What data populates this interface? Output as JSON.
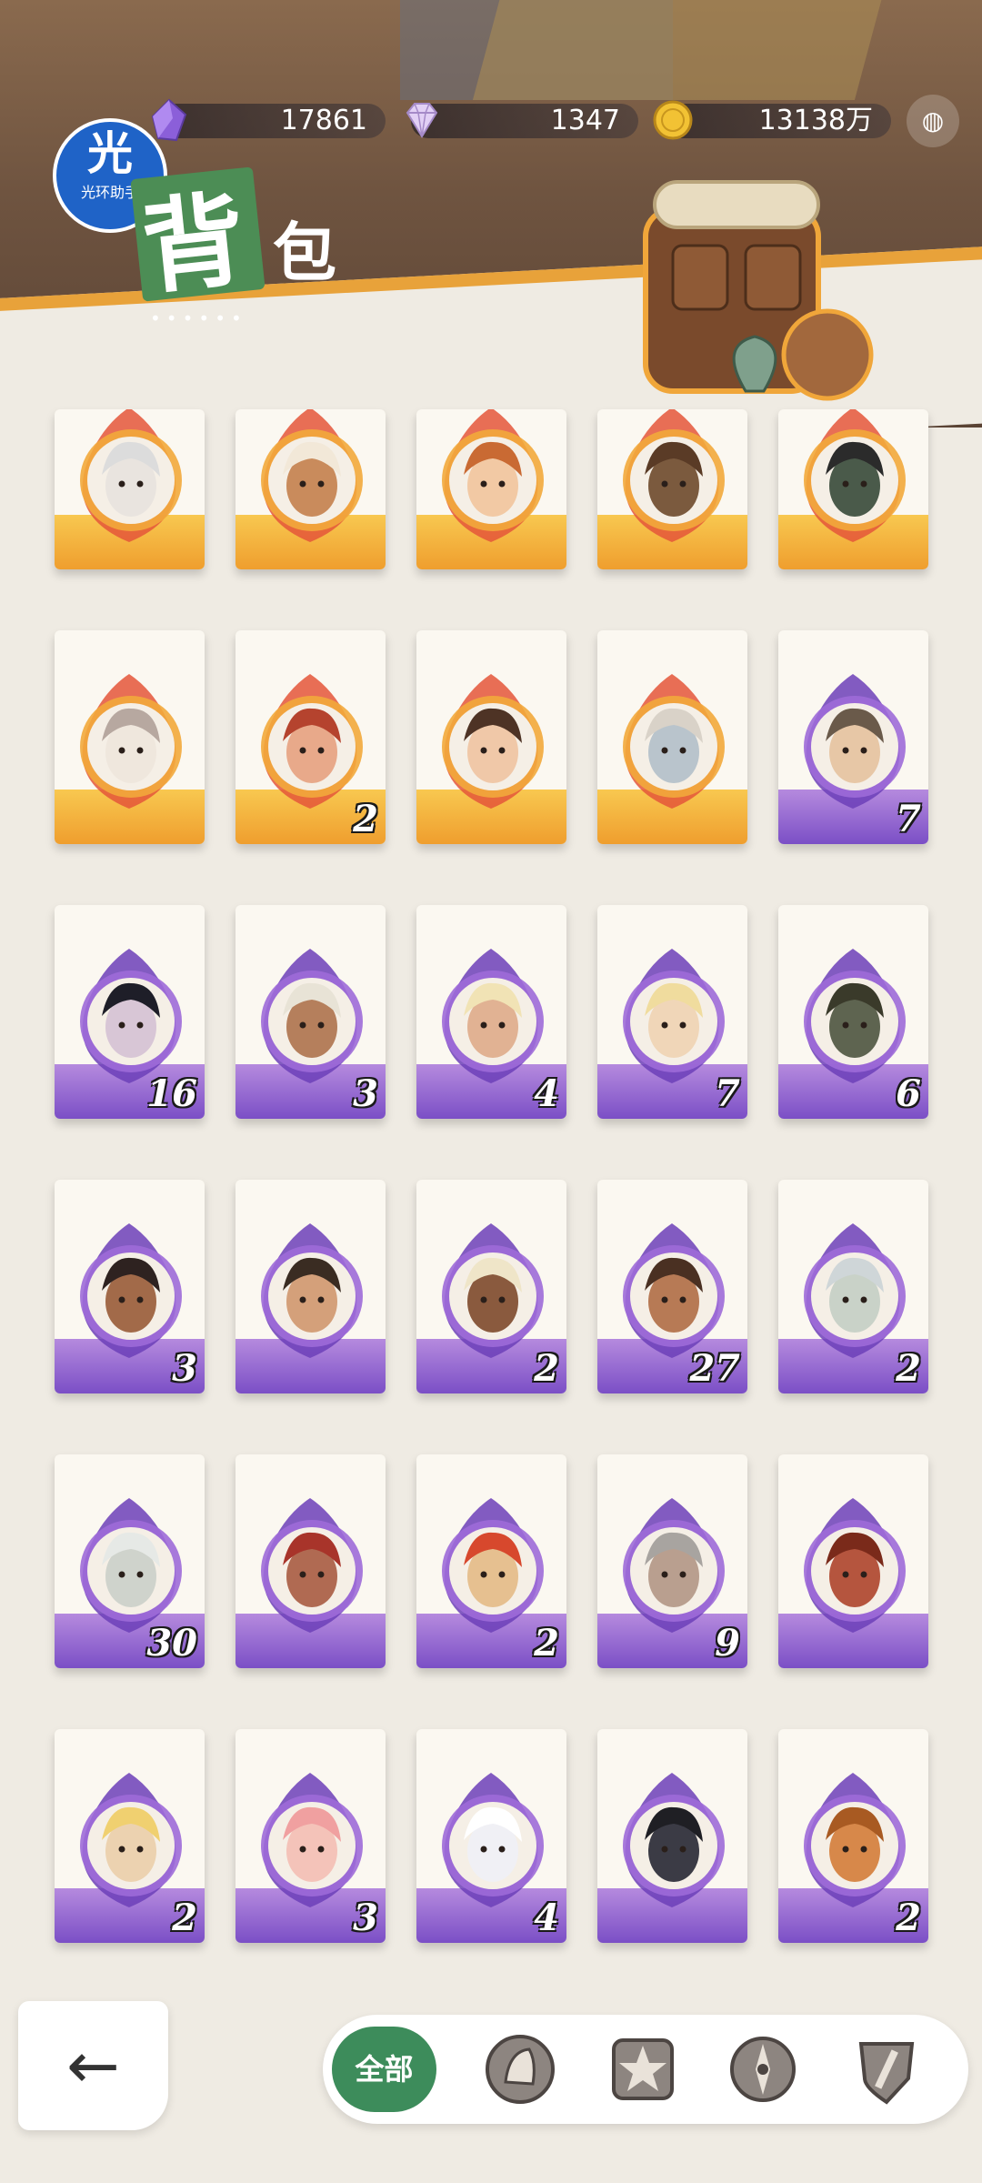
{
  "resources": [
    {
      "name": "purple-crystal",
      "value": "17861",
      "color": "#8b5fd9"
    },
    {
      "name": "diamond",
      "value": "1347",
      "color": "#d9c2f0"
    },
    {
      "name": "gold-coin",
      "value": "13138万",
      "color": "#e2b12c"
    }
  ],
  "badge": {
    "big": "光",
    "small": "光环助手"
  },
  "title": {
    "first": "背",
    "second": "包"
  },
  "cards": [
    {
      "rarity": "gold",
      "count": ""
    },
    {
      "rarity": "gold",
      "count": ""
    },
    {
      "rarity": "gold",
      "count": ""
    },
    {
      "rarity": "gold",
      "count": ""
    },
    {
      "rarity": "gold",
      "count": ""
    },
    {
      "rarity": "gold",
      "count": ""
    },
    {
      "rarity": "gold",
      "count": "2"
    },
    {
      "rarity": "gold",
      "count": ""
    },
    {
      "rarity": "gold",
      "count": ""
    },
    {
      "rarity": "purple",
      "count": "7"
    },
    {
      "rarity": "purple",
      "count": "16"
    },
    {
      "rarity": "purple",
      "count": "3"
    },
    {
      "rarity": "purple",
      "count": "4"
    },
    {
      "rarity": "purple",
      "count": "7"
    },
    {
      "rarity": "purple",
      "count": "6"
    },
    {
      "rarity": "purple",
      "count": "3"
    },
    {
      "rarity": "purple",
      "count": ""
    },
    {
      "rarity": "purple",
      "count": "2"
    },
    {
      "rarity": "purple",
      "count": "27"
    },
    {
      "rarity": "purple",
      "count": "2"
    },
    {
      "rarity": "purple",
      "count": "30"
    },
    {
      "rarity": "purple",
      "count": ""
    },
    {
      "rarity": "purple",
      "count": "2"
    },
    {
      "rarity": "purple",
      "count": "9"
    },
    {
      "rarity": "purple",
      "count": ""
    },
    {
      "rarity": "purple",
      "count": "2"
    },
    {
      "rarity": "purple",
      "count": "3"
    },
    {
      "rarity": "purple",
      "count": "4"
    },
    {
      "rarity": "purple",
      "count": ""
    },
    {
      "rarity": "purple",
      "count": "2"
    }
  ],
  "skin_tones": [
    "#e9e4df",
    "#c98b5c",
    "#f2c9a4",
    "#7b5a3e",
    "#4a5a4a",
    "#efe7dd",
    "#e8a98a",
    "#f0c8a8",
    "#b9c4cc",
    "#e7c7a6",
    "#d8c6d6",
    "#b57f5c",
    "#e1b293",
    "#f0d6b8",
    "#5e6450",
    "#a26a49",
    "#d4a07a",
    "#8a5a3e",
    "#b77a55",
    "#c9d2c8",
    "#cfd3cc",
    "#b06a52",
    "#e6c090",
    "#b99f8f",
    "#b5553e",
    "#ecd2b0",
    "#f4c3b9",
    "#f0f0f5",
    "#3b3b45",
    "#d7884a"
  ],
  "back_label": "←",
  "filters": {
    "all": "全部",
    "icons": [
      "warrior-helmet-icon",
      "star-emblem-icon",
      "compass-icon",
      "shield-sword-icon"
    ]
  },
  "colors": {
    "gold": "#f2a93b",
    "purple": "#9d6ad8",
    "accent_green": "#3d8c5b"
  }
}
